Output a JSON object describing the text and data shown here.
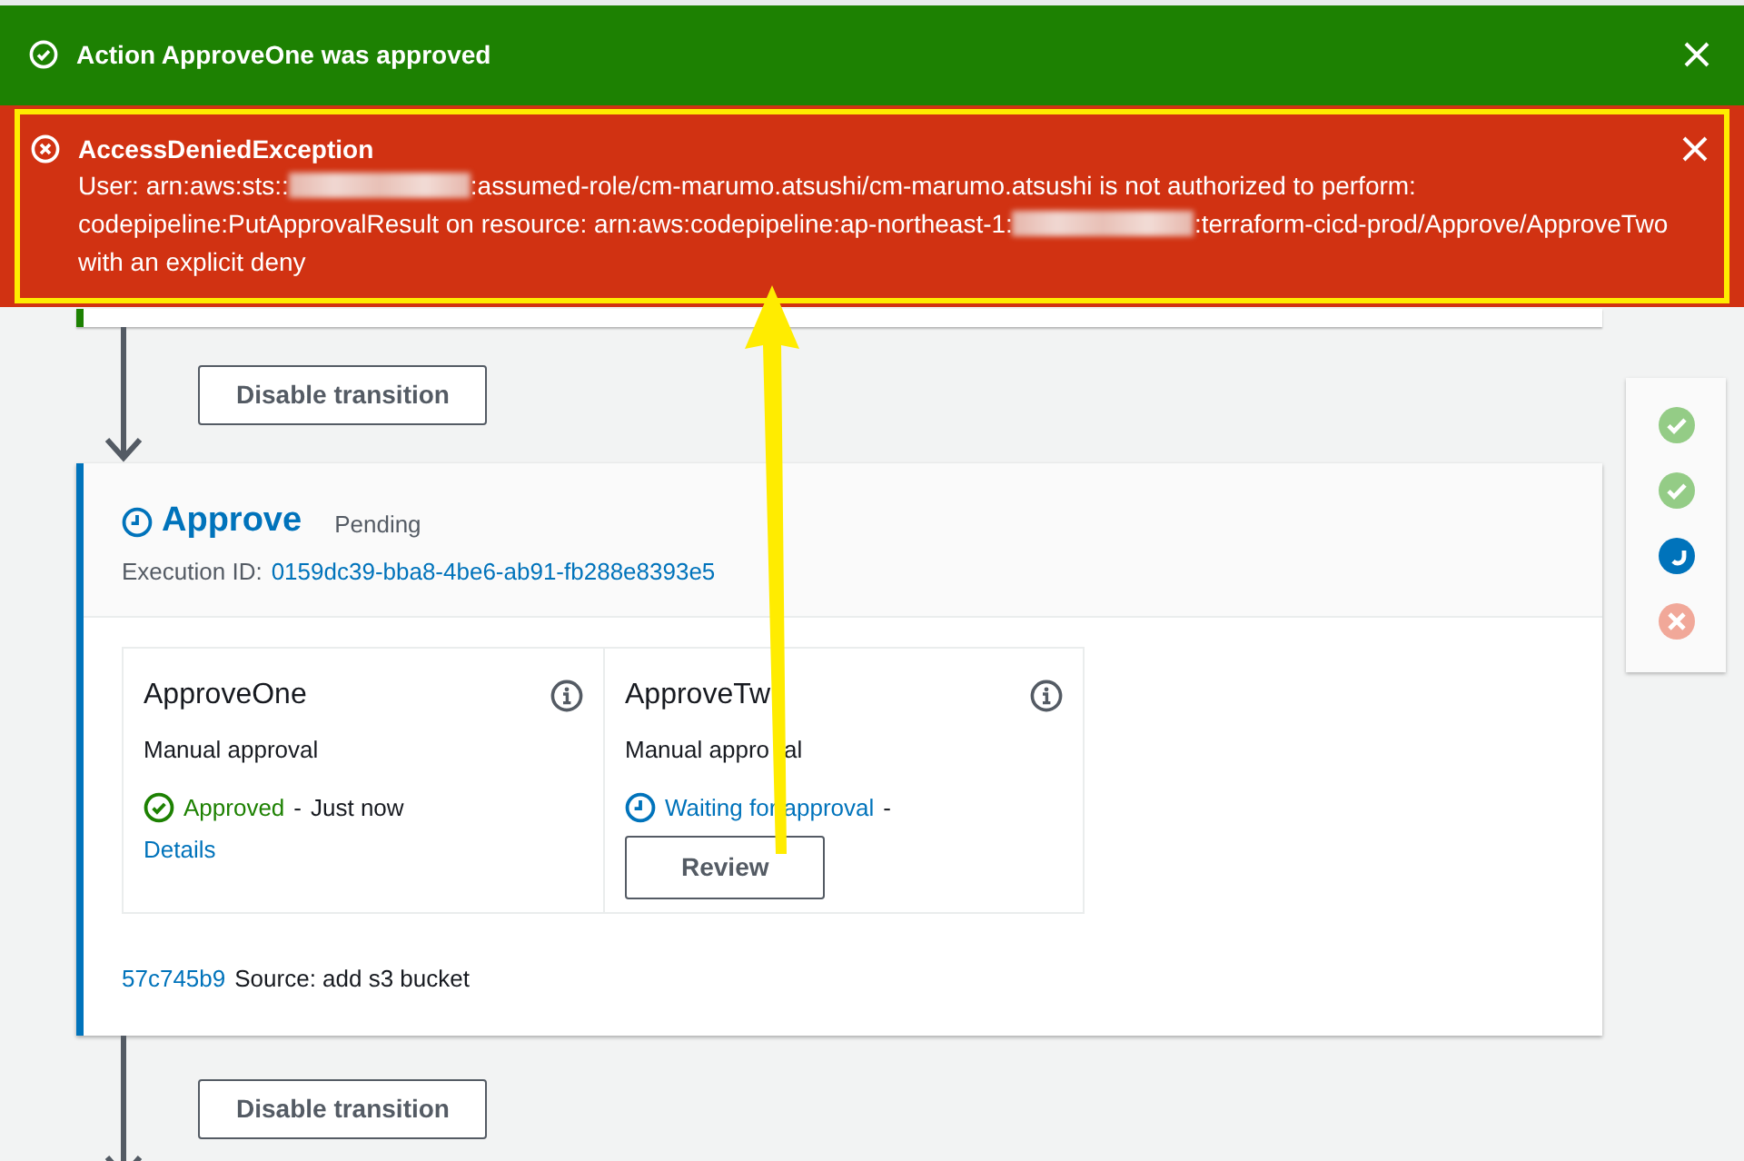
{
  "flashbars": [
    {
      "kind": "success",
      "title": "Action ApproveOne was approved",
      "dismissible": true,
      "highlighted": false
    },
    {
      "kind": "error",
      "title": "AccessDeniedException",
      "dismissible": true,
      "highlighted": true,
      "message": [
        {
          "kind": "text",
          "text": "User: arn:aws:sts::"
        },
        {
          "kind": "redacted"
        },
        {
          "kind": "text",
          "text": ":assumed-role/cm-marumo.atsushi/cm-marumo.atsushi is not authorized to perform: codepipeline:PutApprovalResult on resource: arn:aws:codepipeline:ap-northeast-1:"
        },
        {
          "kind": "redacted"
        },
        {
          "kind": "text",
          "text": ":terraform-cicd-prod/Approve/ApproveTwo with an explicit deny"
        }
      ]
    }
  ],
  "previous_stage": {
    "kind": "succeeded"
  },
  "transitions": [
    {
      "button": "Disable transition"
    },
    {
      "button": "Disable transition"
    }
  ],
  "stage": {
    "name": "Approve",
    "status": "Pending",
    "execution_id_label": "Execution ID:",
    "execution_id": "0159dc39-bba8-4be6-ab91-fb288e8393e5",
    "actions": [
      {
        "name": "ApproveOne",
        "type": "Manual approval",
        "kind": "approved",
        "status": "Approved",
        "separator": "-",
        "time": "Just now",
        "link": "Details"
      },
      {
        "name": "ApproveTw",
        "type": "Manual appro",
        "type_tail": "al",
        "kind": "waiting",
        "status": "Waiting for approval",
        "separator": "-",
        "button": "Review"
      }
    ],
    "commit": "57c745b9",
    "commit_message": "Source: add s3 bucket"
  },
  "stage_navigator": [
    {
      "kind": "succeeded"
    },
    {
      "kind": "succeeded"
    },
    {
      "kind": "in_progress"
    },
    {
      "kind": "failed"
    }
  ]
}
